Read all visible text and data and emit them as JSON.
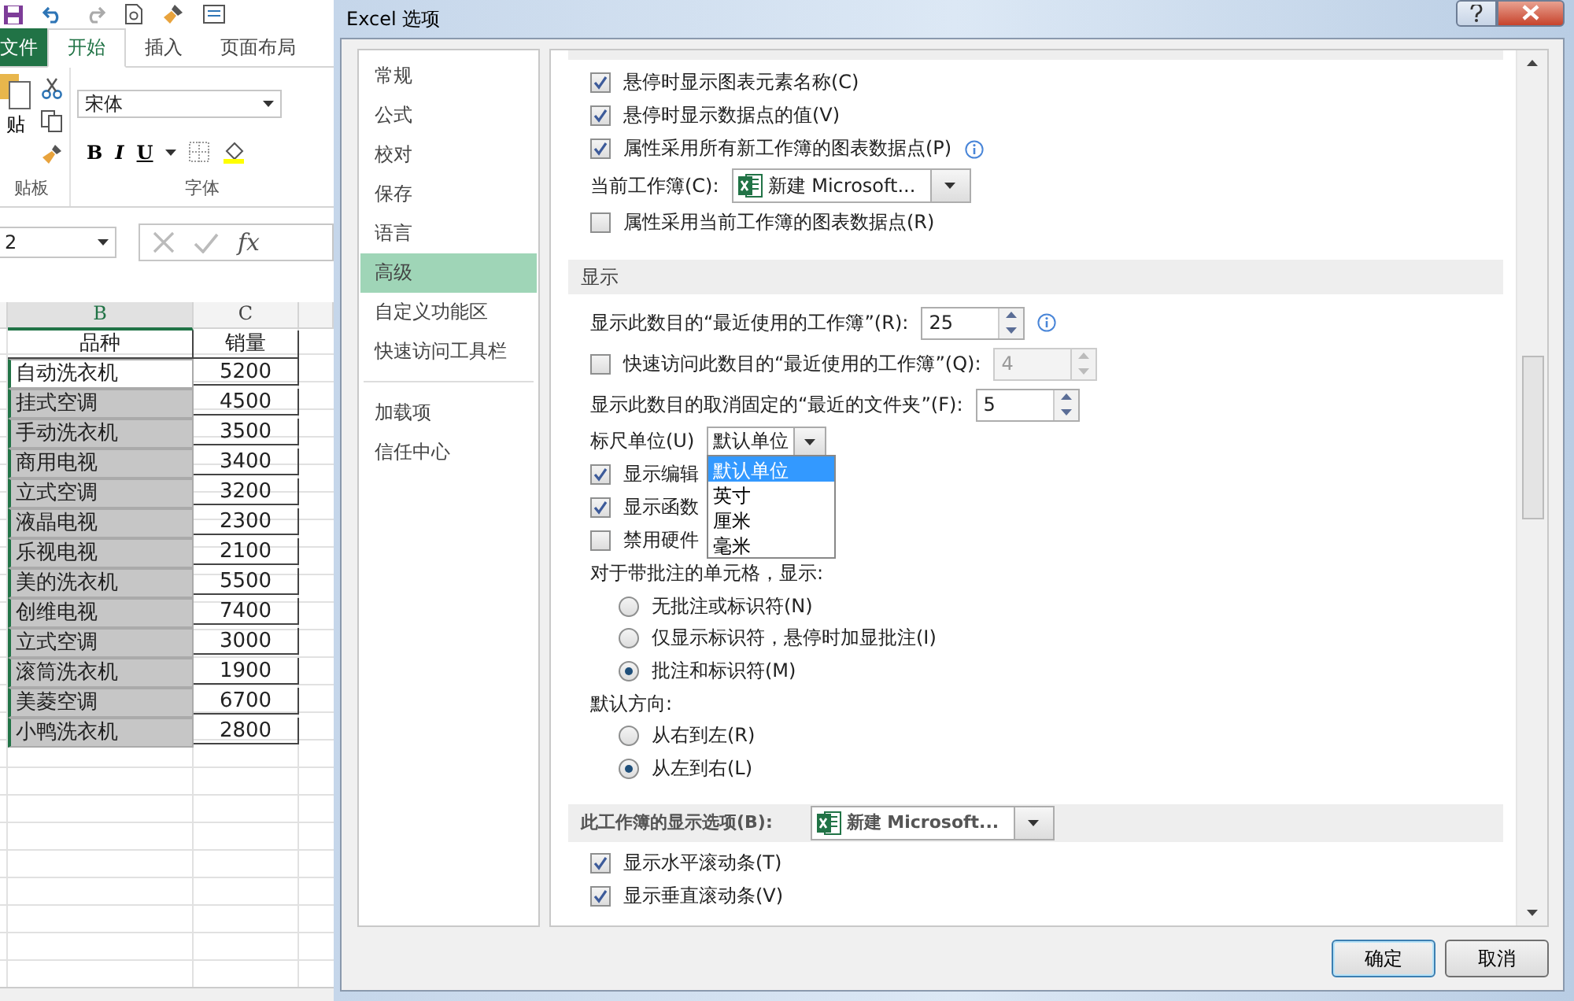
{
  "excel": {
    "tabs": [
      {
        "label": "文件",
        "kind": "file",
        "selected": false
      },
      {
        "label": "开始",
        "kind": "tab",
        "selected": true
      },
      {
        "label": "插入",
        "kind": "tab",
        "selected": false
      },
      {
        "label": "页面布局",
        "kind": "tab",
        "selected": false
      }
    ],
    "ribbon": {
      "paste_label": "贴",
      "font": "宋体",
      "format_buttons": [
        "B",
        "I",
        "U"
      ],
      "groups": [
        "贴板",
        "字体"
      ]
    },
    "formula_bar": {
      "name_box": "2",
      "function_label": "fx"
    },
    "sheet": {
      "columns": [
        {
          "label": "B",
          "selected": true
        },
        {
          "label": "C",
          "selected": false
        }
      ],
      "header": [
        "品种",
        "销量"
      ],
      "rows": [
        {
          "name": "自动洗衣机",
          "sales": "5200",
          "selected": true,
          "active": true
        },
        {
          "name": "挂式空调",
          "sales": "4500",
          "selected": true,
          "active": false
        },
        {
          "name": "手动洗衣机",
          "sales": "3500",
          "selected": true,
          "active": false
        },
        {
          "name": "商用电视",
          "sales": "3400",
          "selected": true,
          "active": false
        },
        {
          "name": "立式空调",
          "sales": "3200",
          "selected": true,
          "active": false
        },
        {
          "name": "液晶电视",
          "sales": "2300",
          "selected": true,
          "active": false
        },
        {
          "name": "乐视电视",
          "sales": "2100",
          "selected": true,
          "active": false
        },
        {
          "name": "美的洗衣机",
          "sales": "5500",
          "selected": true,
          "active": false
        },
        {
          "name": "创维电视",
          "sales": "7400",
          "selected": true,
          "active": false
        },
        {
          "name": "立式空调",
          "sales": "3000",
          "selected": true,
          "active": false
        },
        {
          "name": "滚筒洗衣机",
          "sales": "1900",
          "selected": true,
          "active": false
        },
        {
          "name": "美菱空调",
          "sales": "6700",
          "selected": true,
          "active": false
        },
        {
          "name": "小鸭洗衣机",
          "sales": "2800",
          "selected": true,
          "active": false
        }
      ]
    }
  },
  "dialog": {
    "title": "Excel 选项",
    "nav": [
      {
        "label": "常规",
        "selected": false
      },
      {
        "label": "公式",
        "selected": false
      },
      {
        "label": "校对",
        "selected": false
      },
      {
        "label": "保存",
        "selected": false
      },
      {
        "label": "语言",
        "selected": false
      },
      {
        "label": "高级",
        "selected": true
      },
      {
        "label": "自定义功能区",
        "selected": false
      },
      {
        "label": "快速访问工具栏",
        "selected": false
      },
      {
        "label": "加载项",
        "selected": false
      },
      {
        "label": "信任中心",
        "selected": false
      }
    ],
    "items": [
      {
        "kind": "header"
      },
      {
        "kind": "checkbox",
        "label": "悬停时显示图表元素名称(C)",
        "checked": true
      },
      {
        "kind": "checkbox",
        "label": "悬停时显示数据点的值(V)",
        "checked": true
      },
      {
        "kind": "checkbox",
        "label": "属性采用所有新工作簿的图表数据点(P)",
        "checked": true,
        "info": true
      },
      {
        "kind": "combo",
        "label": "当前工作簿(C):",
        "value": "新建 Microsoft..."
      },
      {
        "kind": "checkbox",
        "label": "属性采用当前工作簿的图表数据点(R)",
        "checked": false
      },
      {
        "kind": "header",
        "label": "显示"
      },
      {
        "kind": "spin",
        "label": "显示此数目的“最近使用的工作簿”(R):",
        "value": "25",
        "info": true,
        "disabled": false
      },
      {
        "kind": "check_spin",
        "label": "快速访问此数目的“最近使用的工作簿”(Q):",
        "checked": false,
        "value": "4",
        "disabled": true
      },
      {
        "kind": "spin",
        "label": "显示此数目的取消固定的“最近的文件夹”(F):",
        "value": "5",
        "disabled": false
      },
      {
        "kind": "select",
        "label": "标尺单位(U)",
        "value": "默认单位",
        "expanded": true,
        "options": [
          {
            "label": "默认单位",
            "selected": true
          },
          {
            "label": "英寸",
            "selected": false
          },
          {
            "label": "厘米",
            "selected": false
          },
          {
            "label": "毫米",
            "selected": false
          }
        ]
      },
      {
        "kind": "checkbox",
        "label": "显示编辑",
        "checked": true
      },
      {
        "kind": "checkbox",
        "label": "显示函数",
        "checked": true
      },
      {
        "kind": "checkbox",
        "label": "禁用硬件",
        "checked": false
      },
      {
        "kind": "label",
        "label": "对于带批注的单元格，显示:"
      },
      {
        "kind": "radio",
        "label": "无批注或标识符(N)",
        "selected": false
      },
      {
        "kind": "radio",
        "label": "仅显示标识符，悬停时加显批注(I)",
        "selected": false
      },
      {
        "kind": "radio",
        "label": "批注和标识符(M)",
        "selected": true
      },
      {
        "kind": "label",
        "label": "默认方向:"
      },
      {
        "kind": "radio",
        "label": "从右到左(R)",
        "selected": false
      },
      {
        "kind": "radio",
        "label": "从左到右(L)",
        "selected": true
      },
      {
        "kind": "header_combo",
        "label": "此工作簿的显示选项(B):",
        "value": "新建 Microsoft..."
      },
      {
        "kind": "checkbox",
        "label": "显示水平滚动条(T)",
        "checked": true
      },
      {
        "kind": "checkbox",
        "label": "显示垂直滚动条(V)",
        "checked": true
      }
    ],
    "buttons": [
      "确定",
      "取消"
    ]
  }
}
